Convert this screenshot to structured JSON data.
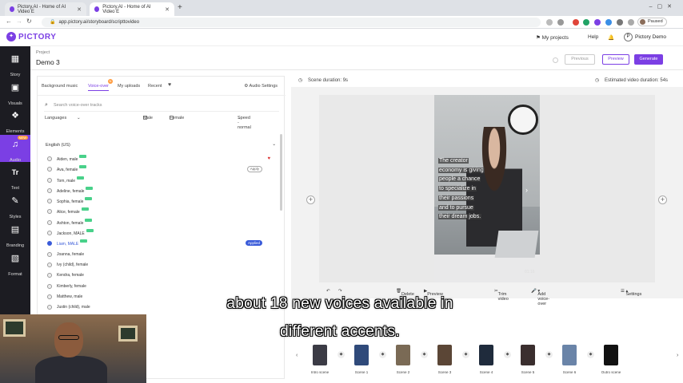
{
  "browser": {
    "tabs": [
      {
        "title": "Pictory.AI - Home of AI Video E"
      },
      {
        "title": "Pictory.AI - Home of AI Video E"
      }
    ],
    "url": "app.pictory.ai/storyboard/scripttovideo",
    "profile_status": "Paused"
  },
  "header": {
    "brand": "PICTORY",
    "my_projects": "My projects",
    "help": "Help",
    "user": "Pictory Demo",
    "user_initial": "P"
  },
  "leftnav": [
    {
      "label": "Story",
      "icon": "story-icon",
      "glyph": "▦"
    },
    {
      "label": "Visuals",
      "icon": "image-icon",
      "glyph": "▣"
    },
    {
      "label": "Elements",
      "icon": "elements-icon",
      "glyph": "❖"
    },
    {
      "label": "Audio",
      "icon": "music-icon",
      "glyph": "♫",
      "badge": "NEW"
    },
    {
      "label": "Text",
      "icon": "text-icon",
      "glyph": "Tr"
    },
    {
      "label": "Styles",
      "icon": "palette-icon",
      "glyph": "✎"
    },
    {
      "label": "Branding",
      "icon": "branding-icon",
      "glyph": "▤"
    },
    {
      "label": "Format",
      "icon": "format-icon",
      "glyph": "▧"
    }
  ],
  "project": {
    "label": "Project",
    "name": "Demo 3",
    "previous": "Previous",
    "preview": "Preview",
    "generate": "Generate"
  },
  "audio": {
    "tabs": {
      "background_music": "Background music",
      "voice_over": "Voice-over",
      "voice_badge": "N",
      "my_uploads": "My uploads",
      "recent": "Recent"
    },
    "settings": "Audio Settings",
    "search_placeholder": "Search voice-over tracks",
    "languages": "Languages",
    "male": "Male",
    "female": "Female",
    "speed": "Speed - normal",
    "language_group": "English (US)",
    "voices": [
      {
        "name": "Aiden, male",
        "new": true,
        "favorite": true
      },
      {
        "name": "Ava, female",
        "new": true,
        "apply": "Apply"
      },
      {
        "name": "Tom, male",
        "new": true
      },
      {
        "name": "Adeline, female",
        "new": true
      },
      {
        "name": "Sophia, female",
        "new": true
      },
      {
        "name": "Alice, female",
        "new": true
      },
      {
        "name": "Ashton, female",
        "new": true
      },
      {
        "name": "Jackson, MALE",
        "new": true
      },
      {
        "name": "Liam, MALE",
        "new": true,
        "selected": true,
        "applied": "Applied"
      },
      {
        "name": "Joanna, female"
      },
      {
        "name": "Ivy (child), female"
      },
      {
        "name": "Kendra, female"
      },
      {
        "name": "Kimberly, female"
      },
      {
        "name": "Matthew, male"
      },
      {
        "name": "Justin (child), male"
      }
    ]
  },
  "stage": {
    "scene_duration": "Scene duration: 9s",
    "estimated": "Estimated video duration: 54s",
    "caption_lines": [
      "The creator",
      "economy is giving",
      "people a chance",
      "to specialize in",
      "their passions",
      "and to pursue",
      "their dream jobs."
    ],
    "page": "01:16",
    "delete": "Delete",
    "preview": "Preview",
    "trim": "Trim video",
    "add_voice": "Add voice-over",
    "settings": "Settings"
  },
  "storyboard": {
    "scenes": [
      "Intro scene",
      "Scene 1",
      "Scene 2",
      "Scene 3",
      "Scene 4",
      "Scene 5",
      "Scene 6",
      "Outro scene"
    ]
  },
  "subtitles": [
    "about 18 new voices available in",
    "different accents."
  ],
  "colors": {
    "brand": "#7b3fe4",
    "applied": "#3a5bd9",
    "new_tag": "#49d18a",
    "favorite": "#dd3333"
  }
}
